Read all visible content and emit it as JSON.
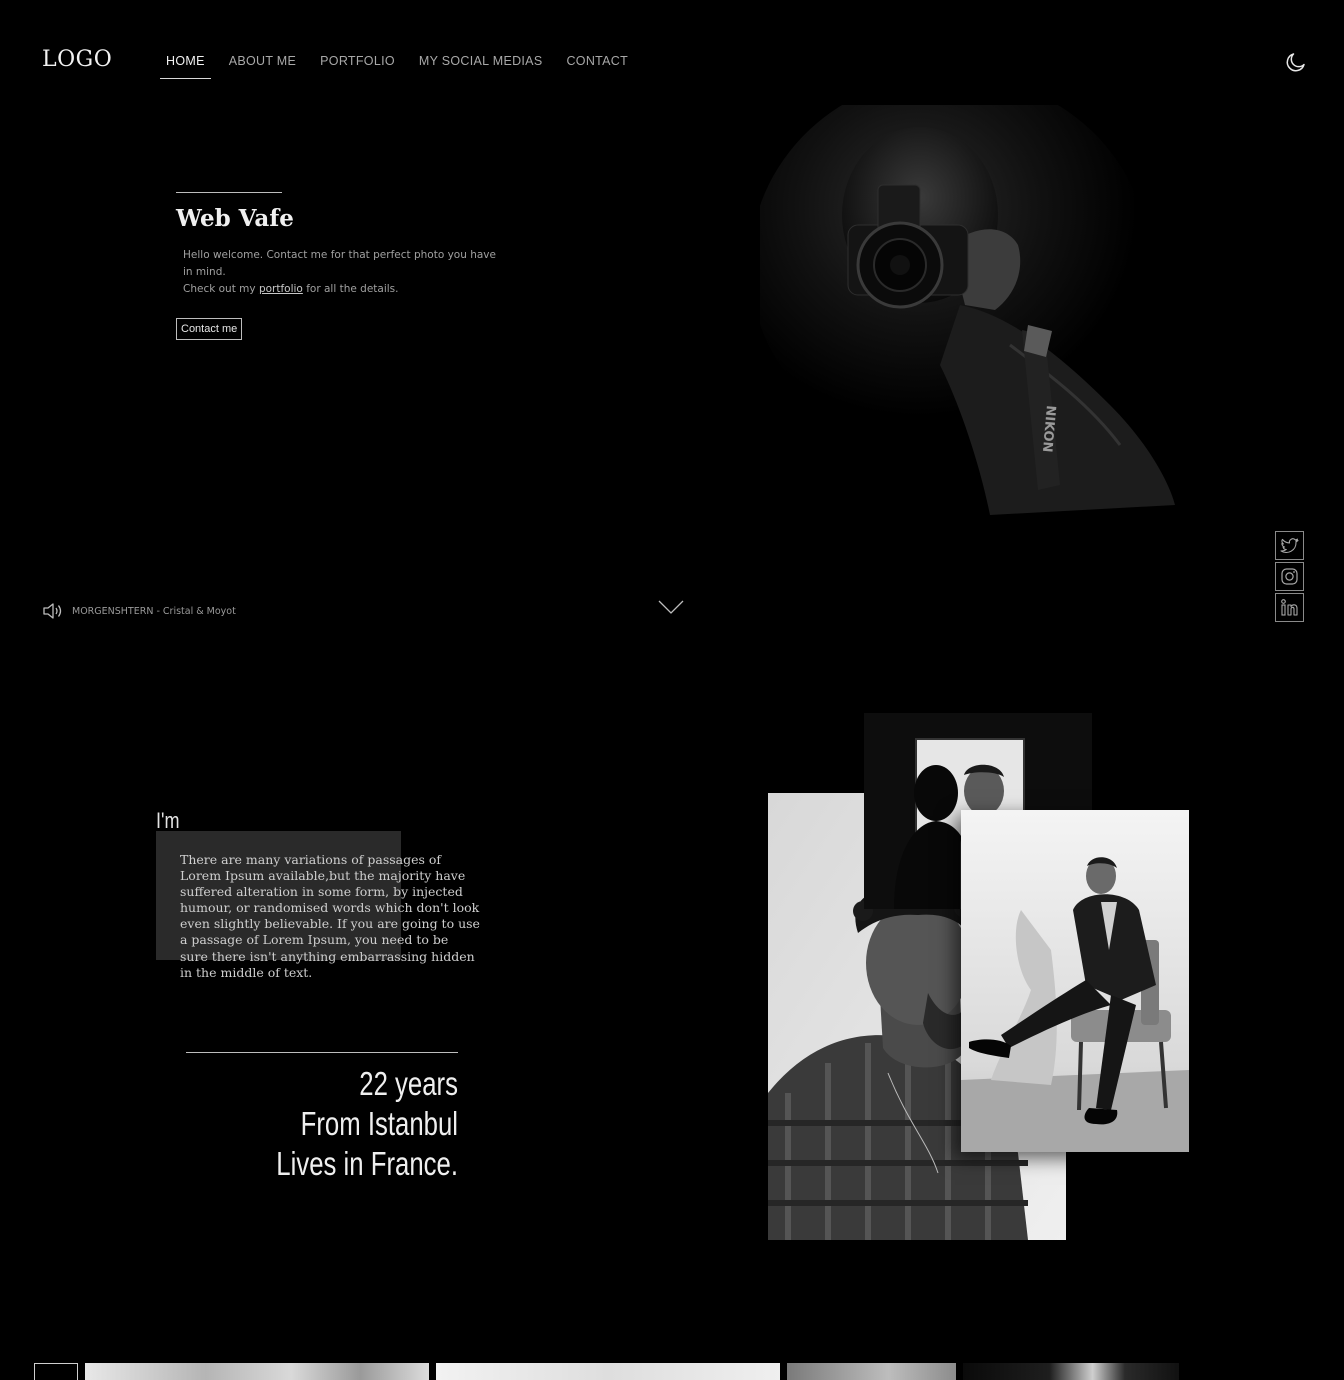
{
  "header": {
    "logo": "LOGO",
    "nav": [
      {
        "label": "HOME",
        "active": true
      },
      {
        "label": "ABOUT ME",
        "active": false
      },
      {
        "label": "PORTFOLIO",
        "active": false
      },
      {
        "label": "MY SOCIAL MEDIAS",
        "active": false
      },
      {
        "label": "CONTACT",
        "active": false
      }
    ],
    "theme_toggle_icon": "moon-icon"
  },
  "hero": {
    "title": "Web Vafe",
    "text_line1": "Hello welcome. Contact me for that perfect photo you have in mind.",
    "text_line2_before": "Check out my ",
    "text_line2_link": "portfolio",
    "text_line2_after": " for all the details.",
    "button": "Contact me",
    "photo_icon": "photographer-with-camera-image"
  },
  "music": {
    "icon": "speaker-icon",
    "now_playing": "MORGENSHTERN - Cristal & Moyot"
  },
  "scroll_icon": "chevron-down-icon",
  "social": [
    {
      "icon": "twitter-icon"
    },
    {
      "icon": "instagram-icon"
    },
    {
      "icon": "linkedin-icon"
    }
  ],
  "about": {
    "heading": "I'm",
    "paragraph": "There are many variations of passages of Lorem Ipsum available,but the majority have suffered alteration in some form, by injected humour, or randomised words which don't look even slightly believable. If you are going to use a passage of Lorem Ipsum, you need to be sure there isn't anything embarrassing hidden in the middle of text.",
    "facts": [
      "22 years",
      "From Istanbul",
      "Lives in France."
    ]
  },
  "colors": {
    "background": "#000000",
    "text_primary": "#f0f0f0",
    "text_muted": "#a0a0a0",
    "panel": "#2a2a2a"
  }
}
